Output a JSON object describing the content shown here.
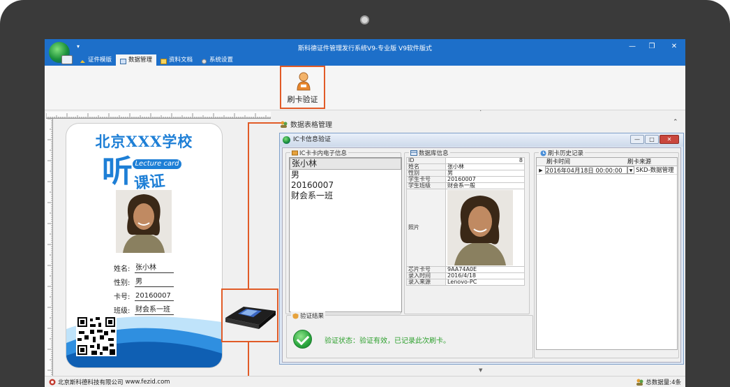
{
  "window": {
    "title": "斯科德证件管理发行系统V9-专业版    V9软件版式",
    "minimize": "—",
    "restore": "❐",
    "close": "✕"
  },
  "ribbon": {
    "quick_access": "▾",
    "tabs": [
      {
        "label": "证件模版",
        "active": false
      },
      {
        "label": "数据管理",
        "active": true
      },
      {
        "label": "资料文档",
        "active": false
      },
      {
        "label": "系统设置",
        "active": false
      }
    ],
    "swipe_button_label": "刷卡验证"
  },
  "card": {
    "school": "北京XXX学校",
    "logo_big": "听",
    "logo_tag": "Lecture card",
    "logo_sub": "课证",
    "fields": [
      {
        "label": "姓名:",
        "value": "张小林"
      },
      {
        "label": "性别:",
        "value": "男"
      },
      {
        "label": "卡号:",
        "value": "20160007"
      },
      {
        "label": "班级:",
        "value": "财会系一班"
      }
    ]
  },
  "grid_section": {
    "title": "数据表格管理",
    "caret": "⌃"
  },
  "dialog": {
    "title": "IC卡信息验证",
    "btn_min": "—",
    "btn_max": "□",
    "btn_close": "✕",
    "ic_panel": {
      "title": "IC卡卡内电子信息",
      "lines": [
        "张小林",
        "男",
        "20160007",
        "财会系一班"
      ]
    },
    "db_panel": {
      "title": "数据库信息",
      "rows": [
        {
          "key": "ID",
          "value": "8"
        },
        {
          "key": "姓名",
          "value": "张小林"
        },
        {
          "key": "性别",
          "value": "男"
        },
        {
          "key": "学生卡号",
          "value": "20160007"
        },
        {
          "key": "学生班级",
          "value": "财会系一般"
        }
      ],
      "photo_label": "照片",
      "rows_after": [
        {
          "key": "芯片卡号",
          "value": "9AA74A0E"
        },
        {
          "key": "录入时间",
          "value": "2016/4/18"
        },
        {
          "key": "录入来源",
          "value": "Lenovo-PC"
        }
      ]
    },
    "history_panel": {
      "title": "刷卡历史记录",
      "columns": [
        "刷卡时间",
        "刷卡来源"
      ],
      "rows": [
        {
          "time": "2016年04月18日 00:00:00",
          "source": "SKD-数据管理"
        }
      ]
    },
    "verify_panel": {
      "title": "验证结果",
      "message": "验证状态：验证有效，已记录此次刷卡。"
    }
  },
  "statusbar": {
    "company": "北京斯科德科技有限公司",
    "url": "www.fezid.com",
    "total": "总数据量:4条"
  },
  "colors": {
    "titlebar": "#1d6fc9",
    "highlight": "#e15b27",
    "success": "#2ea02e",
    "card_blue": "#1e7fd6"
  }
}
